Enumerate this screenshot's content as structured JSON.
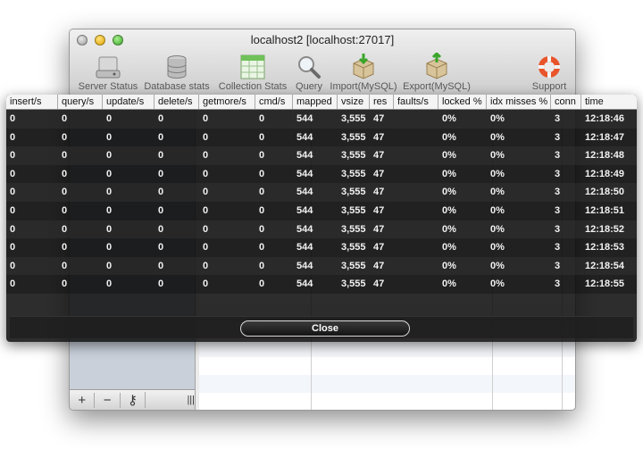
{
  "window": {
    "title": "localhost2 [localhost:27017]"
  },
  "toolbar": {
    "items": [
      {
        "label": "Server Status",
        "icon": "server-status-icon"
      },
      {
        "label": "Database stats",
        "icon": "database-stats-icon"
      },
      {
        "label": "Collection Stats",
        "icon": "collection-stats-icon"
      },
      {
        "label": "Query",
        "icon": "query-magnifier-icon"
      },
      {
        "label": "Import(MySQL)",
        "icon": "import-box-icon"
      },
      {
        "label": "Export(MySQL)",
        "icon": "export-box-icon"
      },
      {
        "label": "Support",
        "icon": "lifebuoy-icon"
      }
    ]
  },
  "sidebar": {
    "bottom_buttons": [
      "+",
      "−",
      "⚷",
      "|||"
    ]
  },
  "stats": {
    "columns": [
      "insert/s",
      "query/s",
      "update/s",
      "delete/s",
      "getmore/s",
      "cmd/s",
      "mapped",
      "vsize",
      "res",
      "faults/s",
      "locked %",
      "idx misses %",
      "conn",
      "time"
    ],
    "rows": [
      [
        "0",
        "0",
        "0",
        "0",
        "0",
        "0",
        "544",
        "3,555",
        "47",
        "",
        "0%",
        "0%",
        "3",
        "12:18:46"
      ],
      [
        "0",
        "0",
        "0",
        "0",
        "0",
        "0",
        "544",
        "3,555",
        "47",
        "",
        "0%",
        "0%",
        "3",
        "12:18:47"
      ],
      [
        "0",
        "0",
        "0",
        "0",
        "0",
        "0",
        "544",
        "3,555",
        "47",
        "",
        "0%",
        "0%",
        "3",
        "12:18:48"
      ],
      [
        "0",
        "0",
        "0",
        "0",
        "0",
        "0",
        "544",
        "3,555",
        "47",
        "",
        "0%",
        "0%",
        "3",
        "12:18:49"
      ],
      [
        "0",
        "0",
        "0",
        "0",
        "0",
        "0",
        "544",
        "3,555",
        "47",
        "",
        "0%",
        "0%",
        "3",
        "12:18:50"
      ],
      [
        "0",
        "0",
        "0",
        "0",
        "0",
        "0",
        "544",
        "3,555",
        "47",
        "",
        "0%",
        "0%",
        "3",
        "12:18:51"
      ],
      [
        "0",
        "0",
        "0",
        "0",
        "0",
        "0",
        "544",
        "3,555",
        "47",
        "",
        "0%",
        "0%",
        "3",
        "12:18:52"
      ],
      [
        "0",
        "0",
        "0",
        "0",
        "0",
        "0",
        "544",
        "3,555",
        "47",
        "",
        "0%",
        "0%",
        "3",
        "12:18:53"
      ],
      [
        "0",
        "0",
        "0",
        "0",
        "0",
        "0",
        "544",
        "3,555",
        "47",
        "",
        "0%",
        "0%",
        "3",
        "12:18:54"
      ],
      [
        "0",
        "0",
        "0",
        "0",
        "0",
        "0",
        "544",
        "3,555",
        "47",
        "",
        "0%",
        "0%",
        "3",
        "12:18:55"
      ]
    ],
    "close_label": "Close"
  }
}
